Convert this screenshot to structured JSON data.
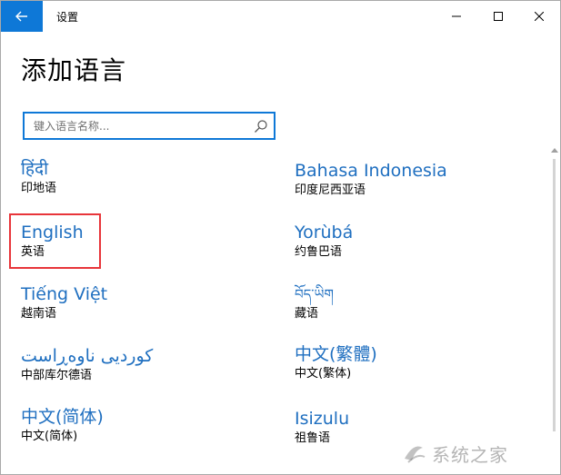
{
  "window": {
    "title": "设置"
  },
  "page": {
    "title": "添加语言"
  },
  "search": {
    "placeholder": "键入语言名称..."
  },
  "languages": [
    {
      "native": "हिंदी",
      "chinese": "印地语"
    },
    {
      "native": "Bahasa Indonesia",
      "chinese": "印度尼西亚语"
    },
    {
      "native": "English",
      "chinese": "英语"
    },
    {
      "native": "Yorùbá",
      "chinese": "约鲁巴语"
    },
    {
      "native": "Tiếng Việt",
      "chinese": "越南语"
    },
    {
      "native": "བོད་ཡིག",
      "chinese": "藏语"
    },
    {
      "native": "کوردیی ناوەڕاست",
      "chinese": "中部库尔德语"
    },
    {
      "native": "中文(繁體)",
      "chinese": "中文(繁体)"
    },
    {
      "native": "中文(简体)",
      "chinese": "中文(简体)"
    },
    {
      "native": "Isizulu",
      "chinese": "祖鲁语"
    }
  ],
  "watermark": {
    "text": "系统之家"
  },
  "colors": {
    "accent": "#0e78d7",
    "link": "#1f6fc0",
    "highlight": "#e8353a"
  }
}
